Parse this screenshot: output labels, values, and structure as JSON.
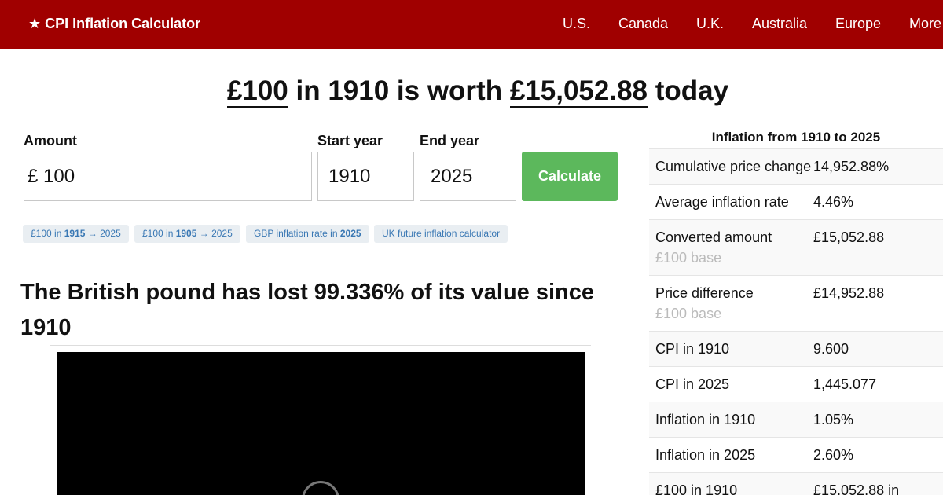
{
  "nav": {
    "brand": "★ CPI Inflation Calculator",
    "links": [
      "U.S.",
      "Canada",
      "U.K.",
      "Australia",
      "Europe",
      "More"
    ]
  },
  "headline": {
    "amount": "£100",
    "middle": " in 1910 is worth ",
    "result": "£15,052.88",
    "end": " today"
  },
  "form": {
    "amount_label": "Amount",
    "currency": "£",
    "amount_value": "100",
    "start_label": "Start year",
    "start_value": "1910",
    "end_label": "End year",
    "end_value": "2025",
    "button": "Calculate"
  },
  "pills": [
    {
      "pre": "£100 in ",
      "bold": "1915",
      "post": " → 2025"
    },
    {
      "pre": "£100 in ",
      "bold": "1905",
      "post": " → 2025"
    },
    {
      "pre": "GBP inflation rate in ",
      "bold": "2025",
      "post": ""
    },
    {
      "pre": "UK future inflation calculator",
      "bold": "",
      "post": ""
    }
  ],
  "section_heading": "The British pound has lost 99.336% of its value since 1910",
  "sidebar": {
    "title": "Inflation from 1910 to 2025",
    "rows": [
      {
        "label": "Cumulative price change",
        "sub": "",
        "value": "14,952.88%"
      },
      {
        "label": "Average inflation rate",
        "sub": "",
        "value": "4.46%"
      },
      {
        "label": "Converted amount",
        "sub": "£100 base",
        "value": "£15,052.88"
      },
      {
        "label": "Price difference",
        "sub": "£100 base",
        "value": "£14,952.88"
      },
      {
        "label": "CPI in 1910",
        "sub": "",
        "value": "9.600"
      },
      {
        "label": "CPI in 2025",
        "sub": "",
        "value": "1,445.077"
      },
      {
        "label": "Inflation in 1910",
        "sub": "",
        "value": "1.05%"
      },
      {
        "label": "Inflation in 2025",
        "sub": "",
        "value": "2.60%"
      },
      {
        "label": "£100 in 1910",
        "sub": "",
        "value": "£15,052.88 in"
      }
    ]
  },
  "colors": {
    "navbar": "#a00000",
    "button": "#5cb85c",
    "link": "#3a78b4"
  }
}
